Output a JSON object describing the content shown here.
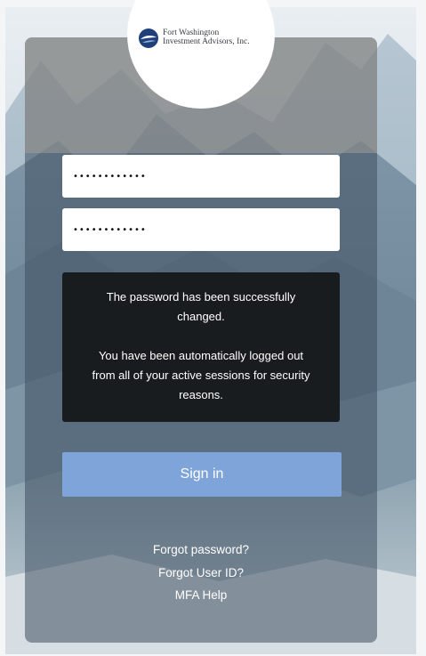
{
  "brand": {
    "line1": "Fort Washington",
    "line2": "Investment Advisors, Inc."
  },
  "form": {
    "user_id_value": "••••••••••••",
    "password_value": "••••••••••••"
  },
  "message": {
    "line1": "The password has been successfully changed.",
    "line2": "You have been automatically logged out from all of your active sessions for security reasons."
  },
  "actions": {
    "sign_in_label": "Sign in"
  },
  "links": {
    "forgot_password": "Forgot password?",
    "forgot_user_id": "Forgot User ID?",
    "mfa_help": "MFA Help"
  },
  "colors": {
    "sign_in_button": "#7fa4d9",
    "message_background": "#191c1e",
    "card_overlay": "#3e4e60"
  }
}
